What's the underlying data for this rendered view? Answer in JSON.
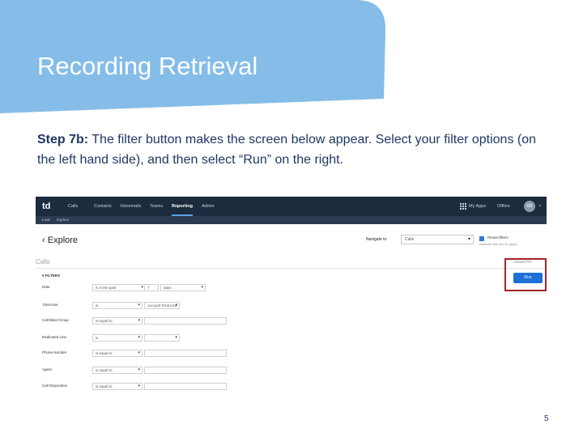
{
  "slide": {
    "title": "Recording Retrieval",
    "step_label": "Step 7b:",
    "step_body": " The filter button makes the screen below appear. Select your filter options (on the left hand side), and then select “Run” on the right.",
    "page_number": "5",
    "colors": {
      "banner": "#85bde8",
      "title_text": "#ffffff",
      "body_text": "#1f3864",
      "highlight_box": "#a32429"
    }
  },
  "screenshot": {
    "logo": "td",
    "nav_items": [
      "Calls",
      "Contacts",
      "Voicemails",
      "Teams",
      "Reporting",
      "Admin"
    ],
    "active_nav": "Reporting",
    "apps_label": "My Apps",
    "status_label": "Offline",
    "avatar_initials": "RR",
    "breadcrumbs": [
      "Look",
      "Explore"
    ],
    "page_title": "Explore",
    "navigate_to_label": "Navigate to:",
    "navigate_to_value": "Calls",
    "checkbox_label": "Persist filters",
    "checkbox_subtext": "Defaults until you re-apply",
    "section_title": "Calls",
    "header_links": "Actions   Pin",
    "filters_heading": "FILTERS",
    "run_label": "Run",
    "filters": [
      {
        "label": "Date",
        "operator": "is in the past",
        "value": "7",
        "unit": "days"
      },
      {
        "label": "Timezone",
        "operator": "is",
        "value": "Account Timezone"
      },
      {
        "label": "Call Blast Group",
        "operator": "is equal to",
        "value": ""
      },
      {
        "label": "Dedicated Line",
        "operator": "is",
        "value": ""
      },
      {
        "label": "Phone Number",
        "operator": "is equal to",
        "value": ""
      },
      {
        "label": "Agent",
        "operator": "is equal to",
        "value": ""
      },
      {
        "label": "Call Disposition",
        "operator": "is equal to",
        "value": ""
      }
    ]
  }
}
